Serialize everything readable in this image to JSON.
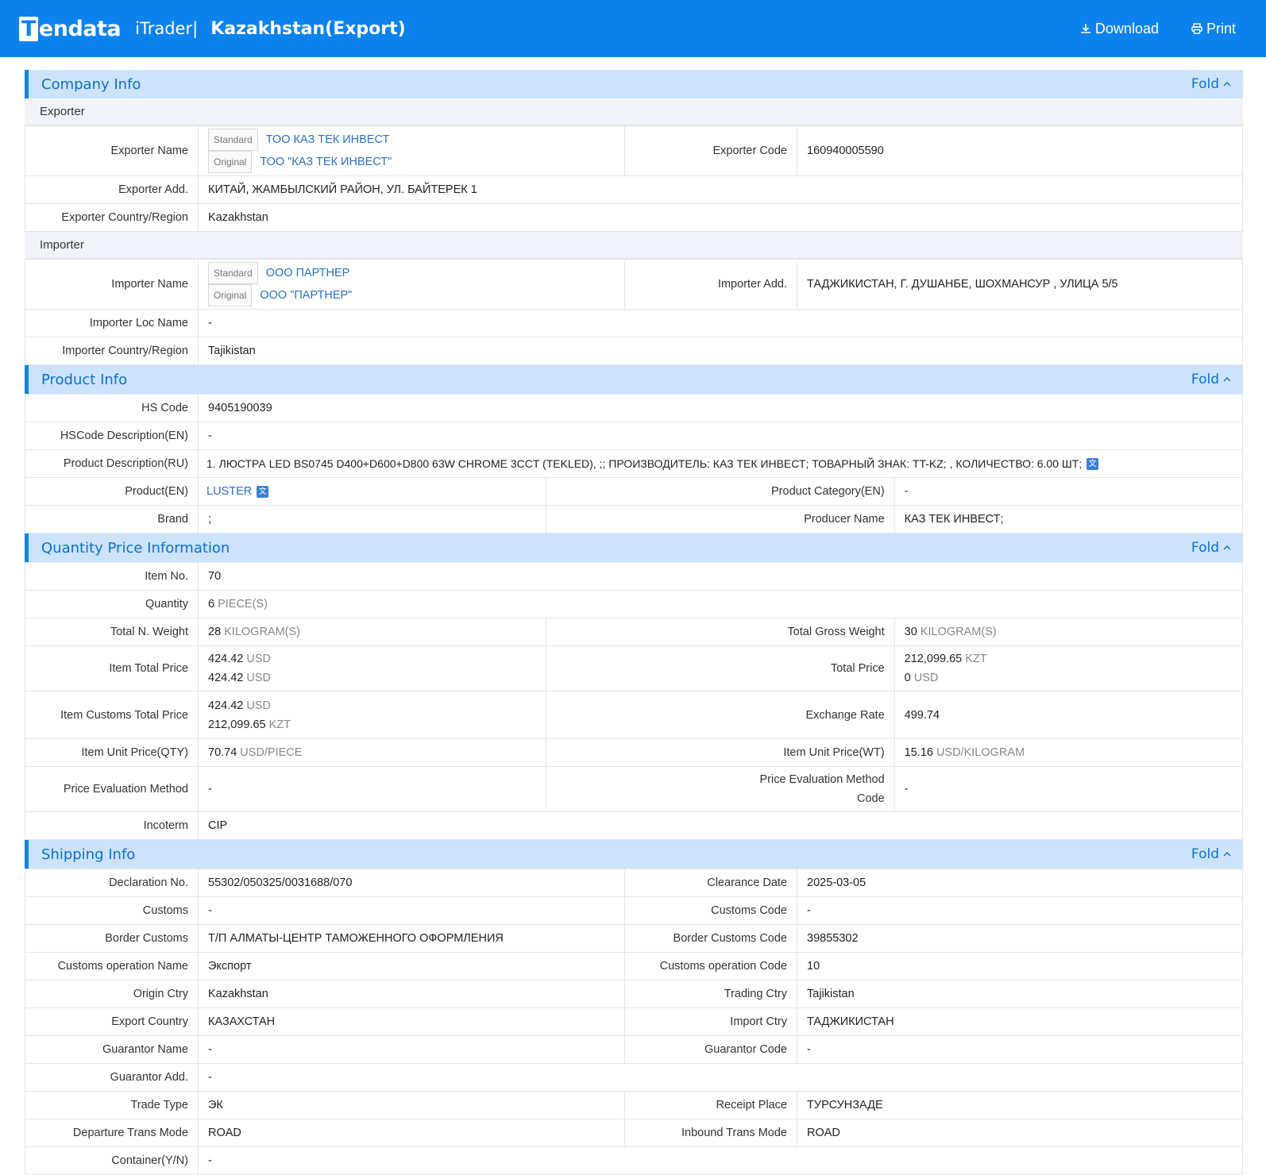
{
  "header": {
    "logo": "Tendata",
    "sub": "iTrader|",
    "title": "Kazakhstan(Export)",
    "download": "Download",
    "print": "Print"
  },
  "fold": "Fold",
  "company": {
    "title": "Company Info",
    "exporter_heading": "Exporter",
    "importer_heading": "Importer",
    "tag_standard": "Standard",
    "tag_original": "Original",
    "exporter_name_label": "Exporter Name",
    "exporter_name_standard": "ТОО КАЗ ТЕК ИНВЕСТ",
    "exporter_name_original": "ТОО \"КАЗ ТЕК ИНВЕСТ\"",
    "exporter_code_label": "Exporter Code",
    "exporter_code": "160940005590",
    "exporter_add_label": "Exporter Add.",
    "exporter_add": "КИТАЙ, ЖАМБЫЛСКИЙ РАЙОН, УЛ. БАЙТЕРЕК 1",
    "exporter_country_label": "Exporter Country/Region",
    "exporter_country": "Kazakhstan",
    "importer_name_label": "Importer Name",
    "importer_name_standard": "ООО ПАРТНЕР",
    "importer_name_original": "ООО \"ПАРТНЕР\"",
    "importer_add_label": "Importer Add.",
    "importer_add": "ТАДЖИКИСТАН, Г. ДУШАНБЕ, ШОХМАНСУР , УЛИЦА 5/5",
    "importer_loc_label": "Importer Loc Name",
    "importer_loc": "-",
    "importer_country_label": "Importer Country/Region",
    "importer_country": "Tajikistan"
  },
  "product": {
    "title": "Product Info",
    "hs_code_label": "HS Code",
    "hs_code": "9405190039",
    "hs_desc_label": "HSCode Description(EN)",
    "hs_desc": "-",
    "desc_ru_label": "Product Description(RU)",
    "desc_ru": "1. ЛЮСТРА LED BS0745 D400+D600+D800 63W CHROME 3CCT (TEKLED), ;; ПРОИЗВОДИТЕЛЬ: КАЗ ТЕК ИНВЕСТ; ТОВАРНЫЙ ЗНАК: TT-KZ; , КОЛИЧЕСТВО: 6.00 ШТ;",
    "product_en_label": "Product(EN)",
    "product_en": "LUSTER",
    "category_label": "Product Category(EN)",
    "category": "-",
    "brand_label": "Brand",
    "brand": ";",
    "producer_label": "Producer Name",
    "producer": "КАЗ ТЕК ИНВЕСТ;"
  },
  "quantity": {
    "title": "Quantity Price Information",
    "item_no_label": "Item No.",
    "item_no": "70",
    "qty_label": "Quantity",
    "qty": "6",
    "qty_unit": "PIECE(S)",
    "net_label": "Total N. Weight",
    "net": "28",
    "net_unit": "KILOGRAM(S)",
    "gross_label": "Total Gross Weight",
    "gross": "30",
    "gross_unit": "KILOGRAM(S)",
    "item_total_label": "Item Total Price",
    "item_total_1": "424.42",
    "item_total_1_unit": "USD",
    "item_total_2": "424.42",
    "item_total_2_unit": "USD",
    "total_price_label": "Total Price",
    "total_price_1": "212,099.65",
    "total_price_1_unit": "KZT",
    "total_price_2": "0",
    "total_price_2_unit": "USD",
    "customs_total_label": "Item Customs Total Price",
    "customs_total_1": "424.42",
    "customs_total_1_unit": "USD",
    "customs_total_2": "212,099.65",
    "customs_total_2_unit": "KZT",
    "exchange_label": "Exchange Rate",
    "exchange": "499.74",
    "unit_qty_label": "Item Unit Price(QTY)",
    "unit_qty": "70.74",
    "unit_qty_unit": "USD/PIECE",
    "unit_wt_label": "Item Unit Price(WT)",
    "unit_wt": "15.16",
    "unit_wt_unit": "USD/KILOGRAM",
    "eval_label": "Price Evaluation Method",
    "eval": "-",
    "eval_code_label_1": "Price Evaluation Method",
    "eval_code_label_2": "Code",
    "eval_code": "-",
    "incoterm_label": "Incoterm",
    "incoterm": "CIP"
  },
  "shipping": {
    "title": "Shipping Info",
    "decl_label": "Declaration No.",
    "decl": "55302/050325/0031688/070",
    "clear_label": "Clearance Date",
    "clear": "2025-03-05",
    "customs_label": "Customs",
    "customs": "-",
    "customs_code_label": "Customs Code",
    "customs_code": "-",
    "border_label": "Border Customs",
    "border": "Т/П АЛМАТЫ-ЦЕНТР ТАМОЖЕННОГО ОФОРМЛЕНИЯ",
    "border_code_label": "Border Customs Code",
    "border_code": "39855302",
    "op_name_label": "Customs operation Name",
    "op_name": "Экспорт",
    "op_code_label": "Customs operation Code",
    "op_code": "10",
    "origin_label": "Origin Ctry",
    "origin": "Kazakhstan",
    "trading_label": "Trading Ctry",
    "trading": "Tajikistan",
    "export_label": "Export Country",
    "export": "КАЗАХСТАН",
    "import_label": "Import Ctry",
    "import": "ТАДЖИКИСТАН",
    "guar_name_label": "Guarantor Name",
    "guar_name": "-",
    "guar_code_label": "Guarantor Code",
    "guar_code": "-",
    "guar_add_label": "Guarantor Add.",
    "guar_add": "-",
    "trade_type_label": "Trade Type",
    "trade_type": "ЭК",
    "receipt_label": "Receipt Place",
    "receipt": "ТУРСУНЗАДЕ",
    "dep_mode_label": "Departure Trans Mode",
    "dep_mode": "ROAD",
    "in_mode_label": "Inbound Trans Mode",
    "in_mode": "ROAD",
    "container_label": "Container(Y/N)",
    "container": "-"
  },
  "colors": {
    "primary": "#0b82ee",
    "section_bg": "#cde3fb",
    "link": "#2a72c9"
  },
  "icons": {
    "download": "download-icon",
    "print": "printer-icon",
    "fold": "chevron-up-icon",
    "translate": "translate-icon"
  }
}
